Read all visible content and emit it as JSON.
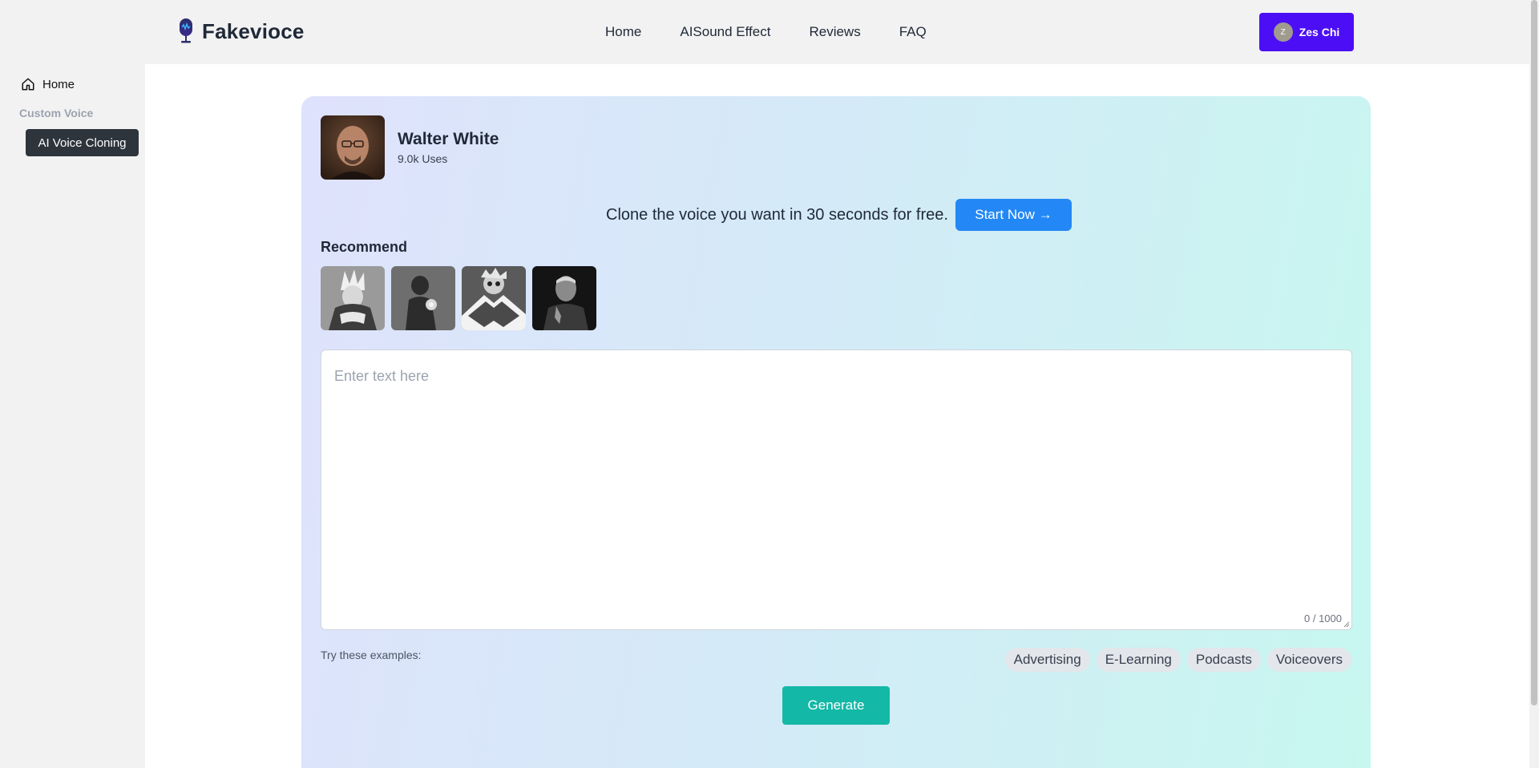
{
  "app": {
    "name": "Fakevioce"
  },
  "nav": {
    "items": [
      "Home",
      "AISound Effect",
      "Reviews",
      "FAQ"
    ]
  },
  "user": {
    "name": "Zes Chi",
    "initial": "Z"
  },
  "sidebar": {
    "home_label": "Home",
    "section_label": "Custom Voice",
    "active_item": "AI Voice Cloning"
  },
  "voice": {
    "name": "Walter White",
    "uses": "9.0k Uses"
  },
  "promo": {
    "text": "Clone the voice you want in 30 seconds for free.",
    "button": "Start Now →"
  },
  "recommend": {
    "title": "Recommend",
    "thumbs": [
      "anime-warrior",
      "dark-figure",
      "cartoon-scientist",
      "older-man-portrait"
    ]
  },
  "editor": {
    "placeholder": "Enter text here",
    "value": "",
    "count": "0 / 1000"
  },
  "examples": {
    "label": "Try these examples:",
    "chips": [
      "Advertising",
      "E-Learning",
      "Podcasts",
      "Voiceovers"
    ]
  },
  "generate": {
    "label": "Generate"
  },
  "colors": {
    "accent_user": "#4c0ff5",
    "start_button": "#2388f5",
    "generate_button": "#14b8a6",
    "sidebar_active": "#2d343c"
  }
}
